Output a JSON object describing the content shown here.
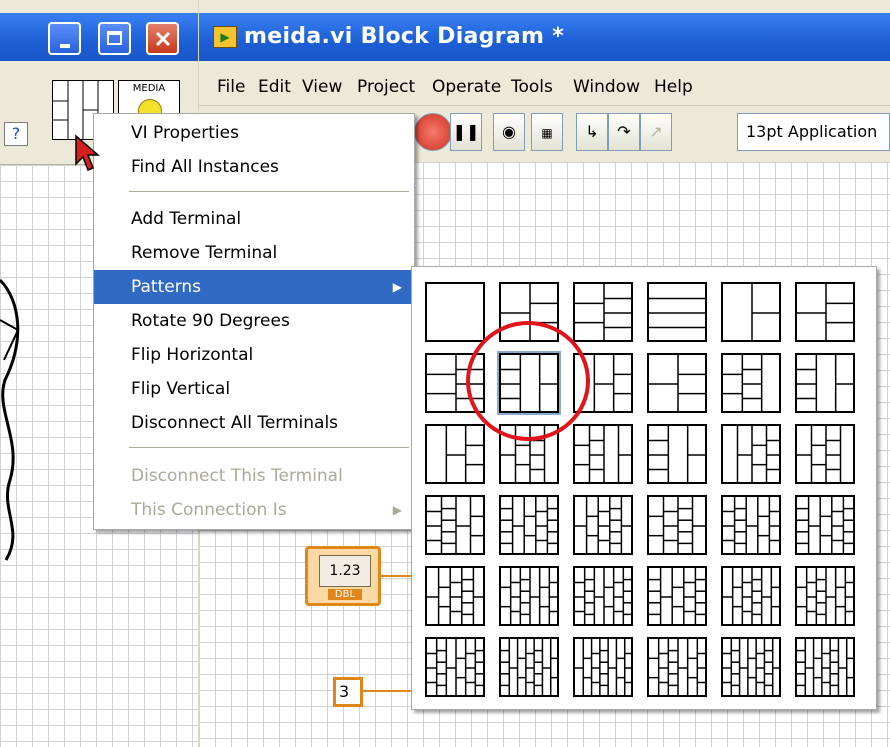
{
  "window": {
    "title": "meida.vi Block Diagram *"
  },
  "front_panel": {
    "media_label": "MEDIA"
  },
  "menubar": {
    "items": [
      "File",
      "Edit",
      "View",
      "Project",
      "Operate",
      "Tools",
      "Window",
      "Help"
    ]
  },
  "toolbar": {
    "font_select": "13pt Application"
  },
  "diagram": {
    "numeric_control_value": "1.23",
    "numeric_control_type": "DBL",
    "constant_value": "3"
  },
  "context_menu": {
    "items": [
      {
        "label": "VI Properties",
        "state": "normal"
      },
      {
        "label": "Find All Instances",
        "state": "normal"
      },
      {
        "label": "Add Terminal",
        "state": "normal"
      },
      {
        "label": "Remove Terminal",
        "state": "normal"
      },
      {
        "label": "Patterns",
        "state": "highlighted",
        "submenu": true
      },
      {
        "label": "Rotate 90 Degrees",
        "state": "normal"
      },
      {
        "label": "Flip Horizontal",
        "state": "normal"
      },
      {
        "label": "Flip Vertical",
        "state": "normal"
      },
      {
        "label": "Disconnect All Terminals",
        "state": "normal"
      },
      {
        "label": "Disconnect This Terminal",
        "state": "disabled"
      },
      {
        "label": "This Connection Is",
        "state": "disabled",
        "submenu": true
      }
    ]
  },
  "patterns_submenu": {
    "rows": 6,
    "columns": 6,
    "selected_pattern": {
      "row": 2,
      "column": 2
    },
    "highlight_color": "#e2141b"
  },
  "colors": {
    "titlebar": "#1d5fd6",
    "menu_highlight": "#316ac5",
    "wire": "#e0871c"
  }
}
